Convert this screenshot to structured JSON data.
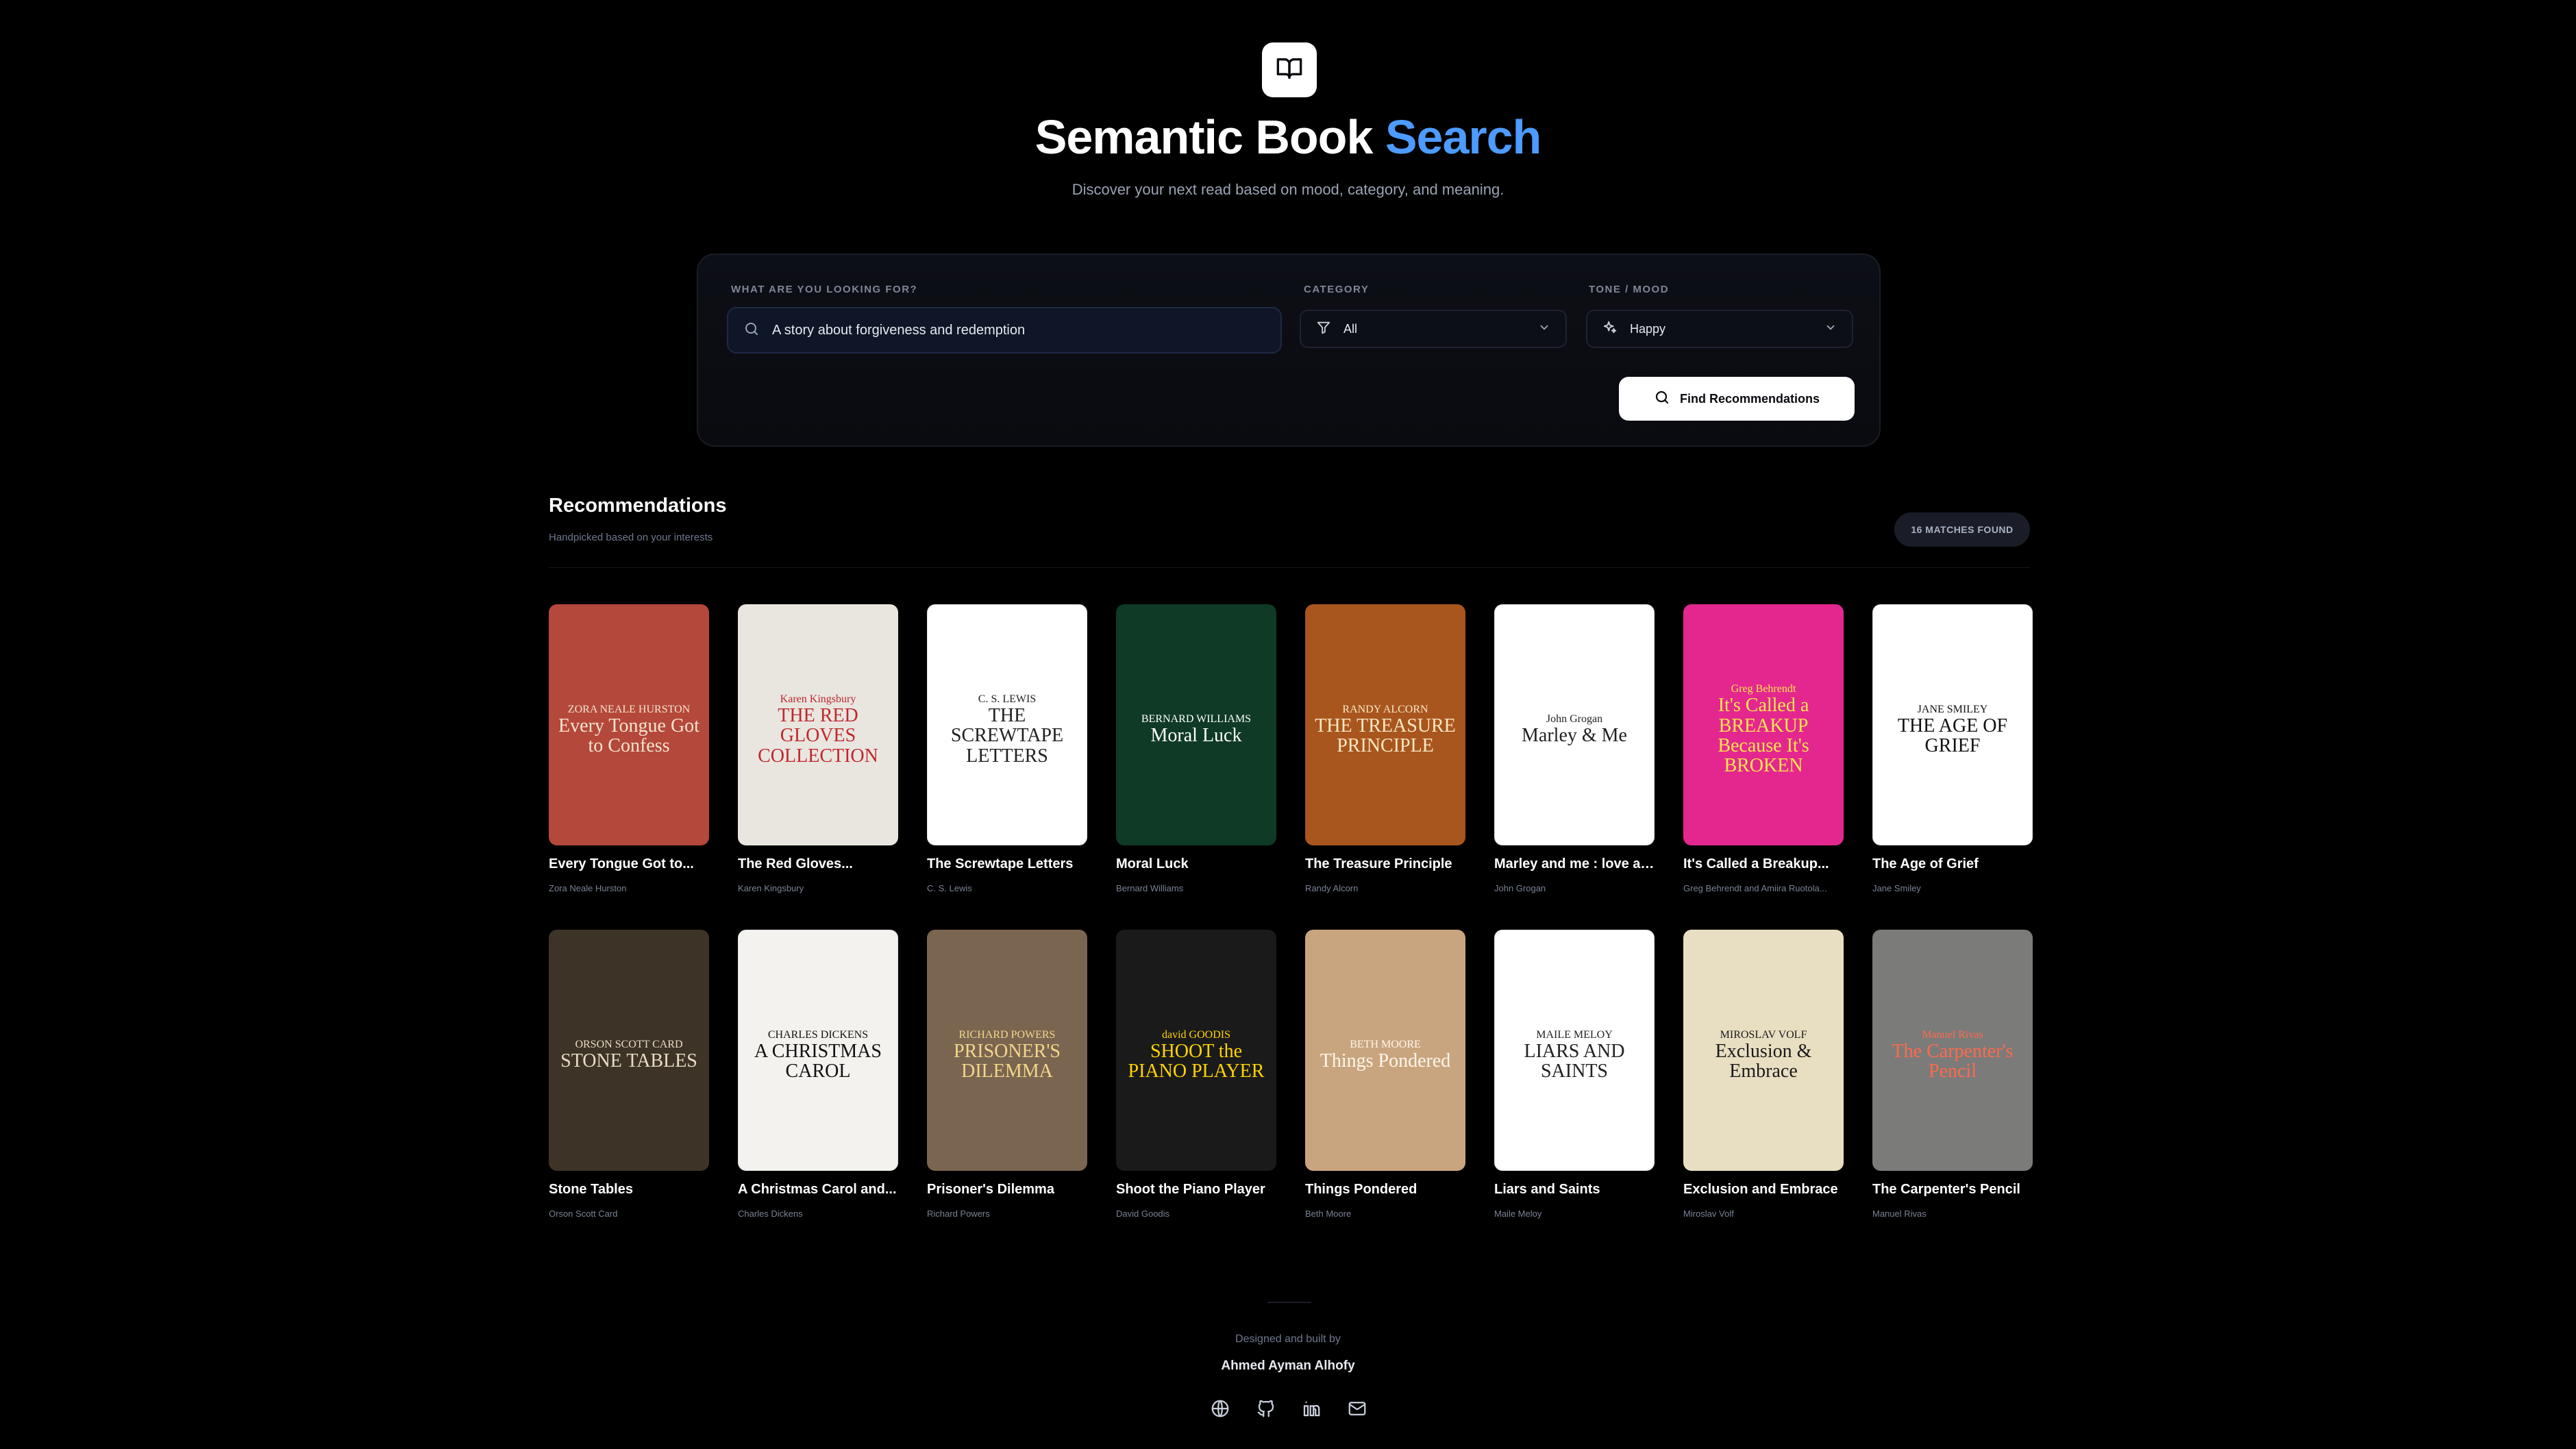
{
  "header": {
    "title_main": "Semantic Book ",
    "title_accent": "Search",
    "subtitle": "Discover your next read based on mood, category, and meaning."
  },
  "search": {
    "query_label": "WHAT ARE YOU LOOKING FOR?",
    "query_value": "A story about forgiveness and redemption",
    "category_label": "CATEGORY",
    "category_value": "All",
    "tone_label": "TONE / MOOD",
    "tone_value": "Happy",
    "submit_label": "Find Recommendations"
  },
  "results": {
    "title": "Recommendations",
    "subtitle": "Handpicked based on your interests",
    "count_badge": "16 MATCHES FOUND"
  },
  "books": [
    {
      "title": "Every Tongue Got to...",
      "author": "Zora Neale Hurston",
      "cover_title": "Every Tongue Got to Confess",
      "cover_author": "ZORA NEALE HURSTON",
      "bg": "#b4483a",
      "fg": "#f5e6d0"
    },
    {
      "title": "The Red Gloves...",
      "author": "Karen Kingsbury",
      "cover_title": "THE RED GLOVES COLLECTION",
      "cover_author": "Karen Kingsbury",
      "bg": "#e9e6e0",
      "fg": "#c0272d"
    },
    {
      "title": "The Screwtape Letters",
      "author": "C. S. Lewis",
      "cover_title": "THE SCREWTAPE LETTERS",
      "cover_author": "C. S. LEWIS",
      "bg": "#ffffff",
      "fg": "#222222"
    },
    {
      "title": "Moral Luck",
      "author": "Bernard Williams",
      "cover_title": "Moral Luck",
      "cover_author": "BERNARD WILLIAMS",
      "bg": "#0f3a26",
      "fg": "#ffffff"
    },
    {
      "title": "The Treasure Principle",
      "author": "Randy Alcorn",
      "cover_title": "THE TREASURE PRINCIPLE",
      "cover_author": "RANDY ALCORN",
      "bg": "#a8561e",
      "fg": "#fbe8c4"
    },
    {
      "title": "Marley and me : love an...",
      "author": "John Grogan",
      "cover_title": "Marley & Me",
      "cover_author": "John Grogan",
      "bg": "#ffffff",
      "fg": "#222222"
    },
    {
      "title": "It's Called a Breakup...",
      "author": "Greg Behrendt and Amiira Ruotola...",
      "cover_title": "It's Called a BREAKUP Because It's BROKEN",
      "cover_author": "Greg Behrendt",
      "bg": "#e4278f",
      "fg": "#ffe84a"
    },
    {
      "title": "The Age of Grief",
      "author": "Jane Smiley",
      "cover_title": "THE AGE OF GRIEF",
      "cover_author": "JANE SMILEY",
      "bg": "#ffffff",
      "fg": "#111111"
    },
    {
      "title": "Stone Tables",
      "author": "Orson Scott Card",
      "cover_title": "STONE TABLES",
      "cover_author": "ORSON SCOTT CARD",
      "bg": "#3d3427",
      "fg": "#e8dcc4"
    },
    {
      "title": "A Christmas Carol and...",
      "author": "Charles Dickens",
      "cover_title": "A CHRISTMAS CAROL",
      "cover_author": "CHARLES DICKENS",
      "bg": "#f4f2ee",
      "fg": "#111111"
    },
    {
      "title": "Prisoner's Dilemma",
      "author": "Richard Powers",
      "cover_title": "PRISONER'S DILEMMA",
      "cover_author": "RICHARD POWERS",
      "bg": "#7a6550",
      "fg": "#f2d78a"
    },
    {
      "title": "Shoot the Piano Player",
      "author": "David Goodis",
      "cover_title": "SHOOT the PIANO PLAYER",
      "cover_author": "david GOODIS",
      "bg": "#1a1a1a",
      "fg": "#ffd400"
    },
    {
      "title": "Things Pondered",
      "author": "Beth Moore",
      "cover_title": "Things Pondered",
      "cover_author": "BETH MOORE",
      "bg": "#c9a57f",
      "fg": "#fff7ea"
    },
    {
      "title": "Liars and Saints",
      "author": "Maile Meloy",
      "cover_title": "LIARS AND SAINTS",
      "cover_author": "MAILE MELOY",
      "bg": "#ffffff",
      "fg": "#222222"
    },
    {
      "title": "Exclusion and Embrace",
      "author": "Miroslav Volf",
      "cover_title": "Exclusion & Embrace",
      "cover_author": "MIROSLAV VOLF",
      "bg": "#e8dfc2",
      "fg": "#1a1a1a"
    },
    {
      "title": "The Carpenter's Pencil",
      "author": "Manuel Rivas",
      "cover_title": "The Carpenter's Pencil",
      "cover_author": "Manuel Rivas",
      "bg": "#7b7b79",
      "fg": "#ff6a4d"
    }
  ],
  "footer": {
    "credit_label": "Designed and built by",
    "author_name": "Ahmed Ayman Alhofy",
    "links": [
      "globe-icon",
      "github-icon",
      "linkedin-icon",
      "mail-icon"
    ]
  },
  "colors": {
    "background": "#000000",
    "accent": "#4d9bff",
    "panel": "#0d0f16",
    "muted_text": "#7a8296"
  }
}
